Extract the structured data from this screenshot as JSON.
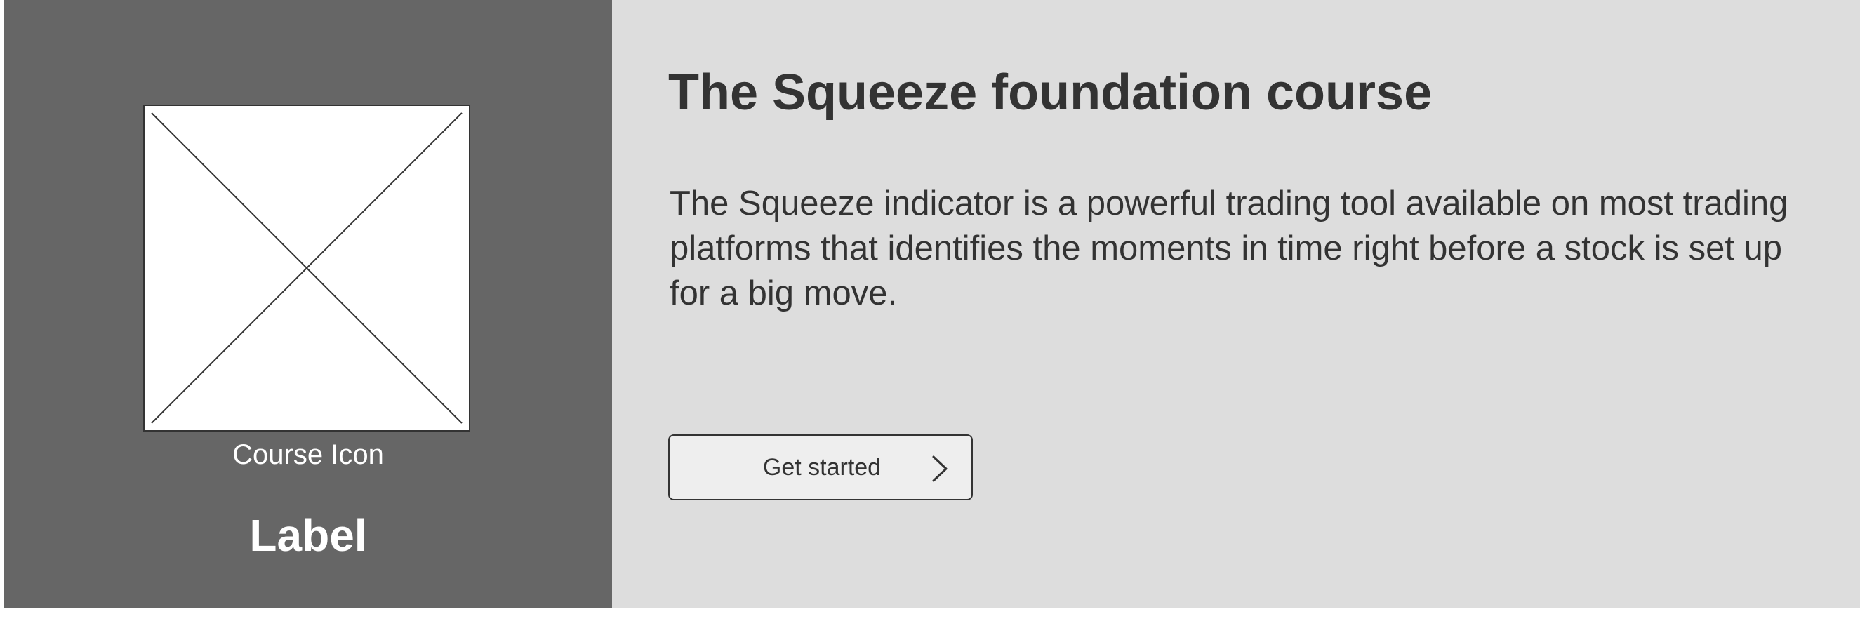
{
  "media": {
    "icon_caption": "Course Icon",
    "label": "Label"
  },
  "course": {
    "title": "The Squeeze foundation course",
    "description": "The Squeeze indicator is a powerful trading tool available on most trading platforms that identifies the moments in time right before a stock is set up for a big move."
  },
  "cta": {
    "label": "Get started",
    "icon": "chevron-right-icon"
  },
  "colors": {
    "left_panel_bg": "#666666",
    "right_panel_bg": "#dddddd",
    "text_dark": "#333333",
    "button_bg": "#eeeeee"
  }
}
